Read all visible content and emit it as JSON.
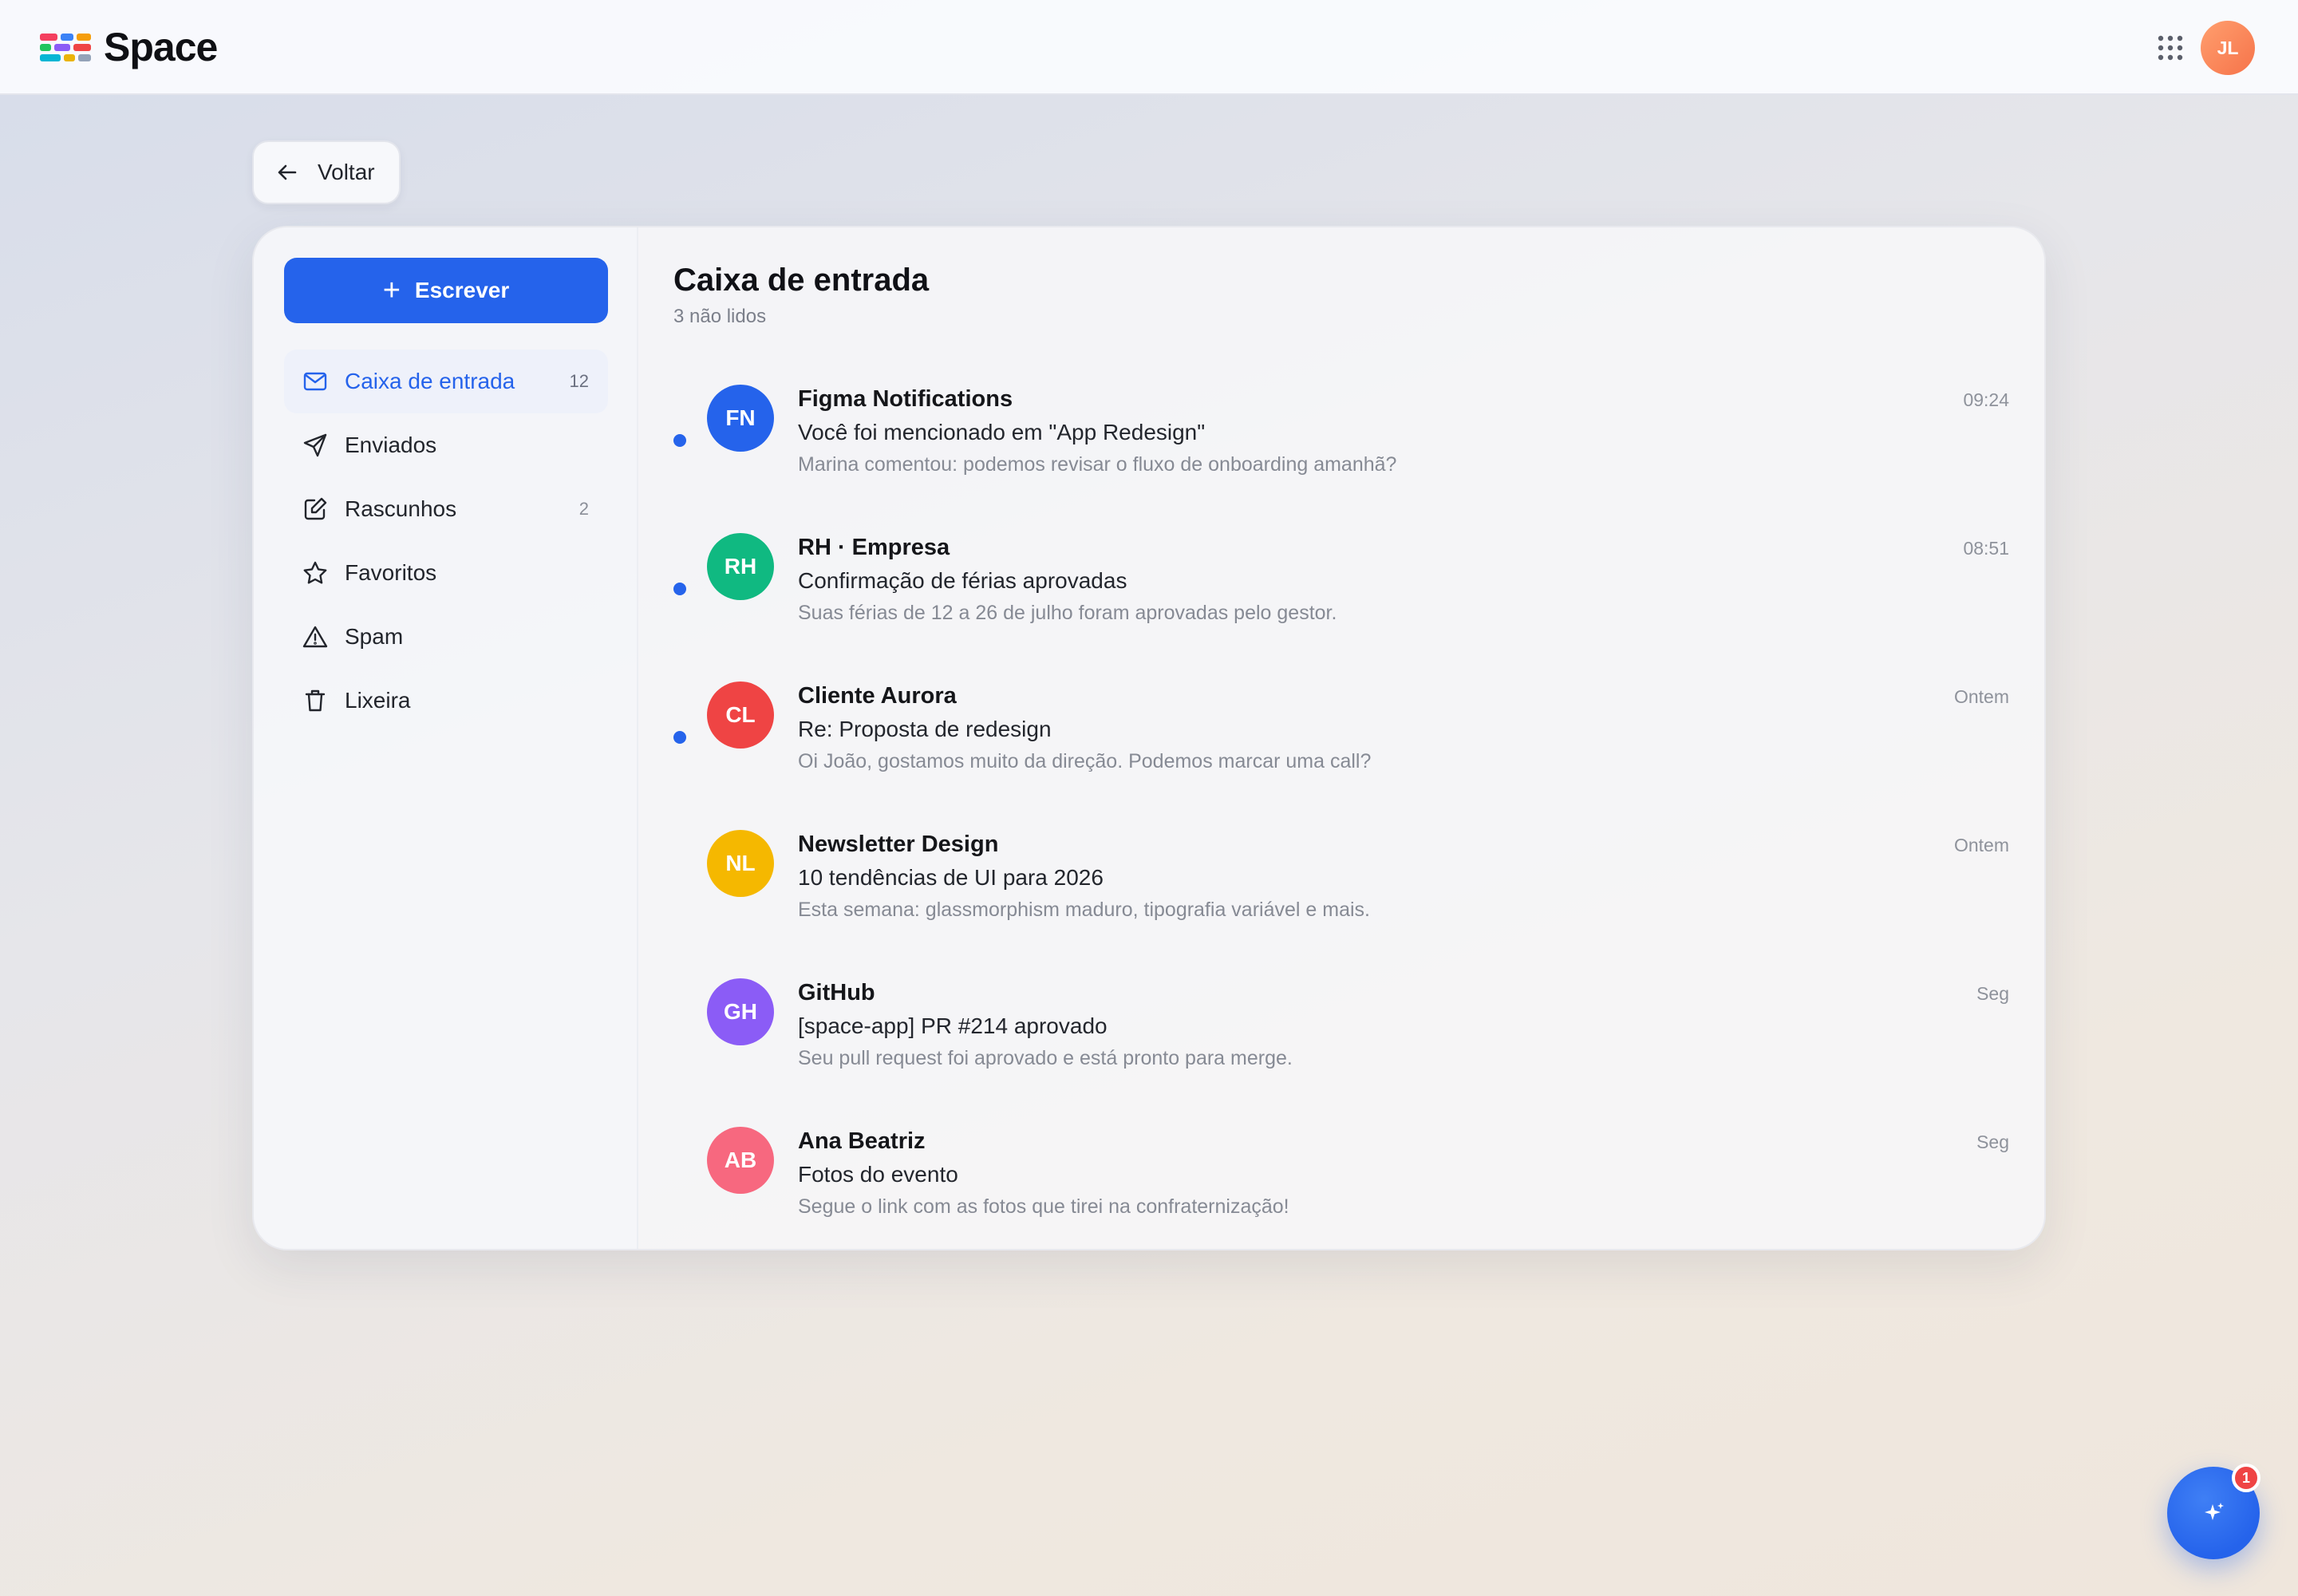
{
  "app": {
    "name": "Space",
    "avatar_initials": "JL",
    "avatar_color": "#f6734a",
    "accent_color": "#2563eb"
  },
  "back_button": {
    "label": "Voltar",
    "icon": "arrow-left-icon"
  },
  "sidebar": {
    "compose_label": "Escrever",
    "items": [
      {
        "label": "Caixa de entrada",
        "count": "12",
        "icon": "mail-icon",
        "active": true
      },
      {
        "label": "Enviados",
        "count": "",
        "icon": "send-icon",
        "active": false
      },
      {
        "label": "Rascunhos",
        "count": "2",
        "icon": "edit-icon",
        "active": false
      },
      {
        "label": "Favoritos",
        "count": "",
        "icon": "star-icon",
        "active": false
      },
      {
        "label": "Spam",
        "count": "",
        "icon": "alert-icon",
        "active": false
      },
      {
        "label": "Lixeira",
        "count": "",
        "icon": "trash-icon",
        "active": false
      }
    ]
  },
  "inbox": {
    "title": "Caixa de entrada",
    "subtitle": "3 não lidos",
    "messages": [
      {
        "initials": "FN",
        "color": "#2563eb",
        "sender": "Figma Notifications",
        "subject": "Você foi mencionado em \"App Redesign\"",
        "preview": "Marina comentou: podemos revisar o fluxo de onboarding amanhã?",
        "time": "09:24",
        "unread": true
      },
      {
        "initials": "RH",
        "color": "#10b981",
        "sender": "RH · Empresa",
        "subject": "Confirmação de férias aprovadas",
        "preview": "Suas férias de 12 a 26 de julho foram aprovadas pelo gestor.",
        "time": "08:51",
        "unread": true
      },
      {
        "initials": "CL",
        "color": "#ef4444",
        "sender": "Cliente Aurora",
        "subject": "Re: Proposta de redesign",
        "preview": "Oi João, gostamos muito da direção. Podemos marcar uma call?",
        "time": "Ontem",
        "unread": true
      },
      {
        "initials": "NL",
        "color": "#f5b800",
        "sender": "Newsletter Design",
        "subject": "10 tendências de UI para 2026",
        "preview": "Esta semana: glassmorphism maduro, tipografia variável e mais.",
        "time": "Ontem",
        "unread": false
      },
      {
        "initials": "GH",
        "color": "#8b5cf6",
        "sender": "GitHub",
        "subject": "[space-app] PR #214 aprovado",
        "preview": "Seu pull request foi aprovado e está pronto para merge.",
        "time": "Seg",
        "unread": false
      },
      {
        "initials": "AB",
        "color": "#f7687f",
        "sender": "Ana Beatriz",
        "subject": "Fotos do evento",
        "preview": "Segue o link com as fotos que tirei na confraternização!",
        "time": "Seg",
        "unread": false
      }
    ]
  },
  "fab": {
    "badge": "1",
    "icon": "sparkle-icon"
  }
}
